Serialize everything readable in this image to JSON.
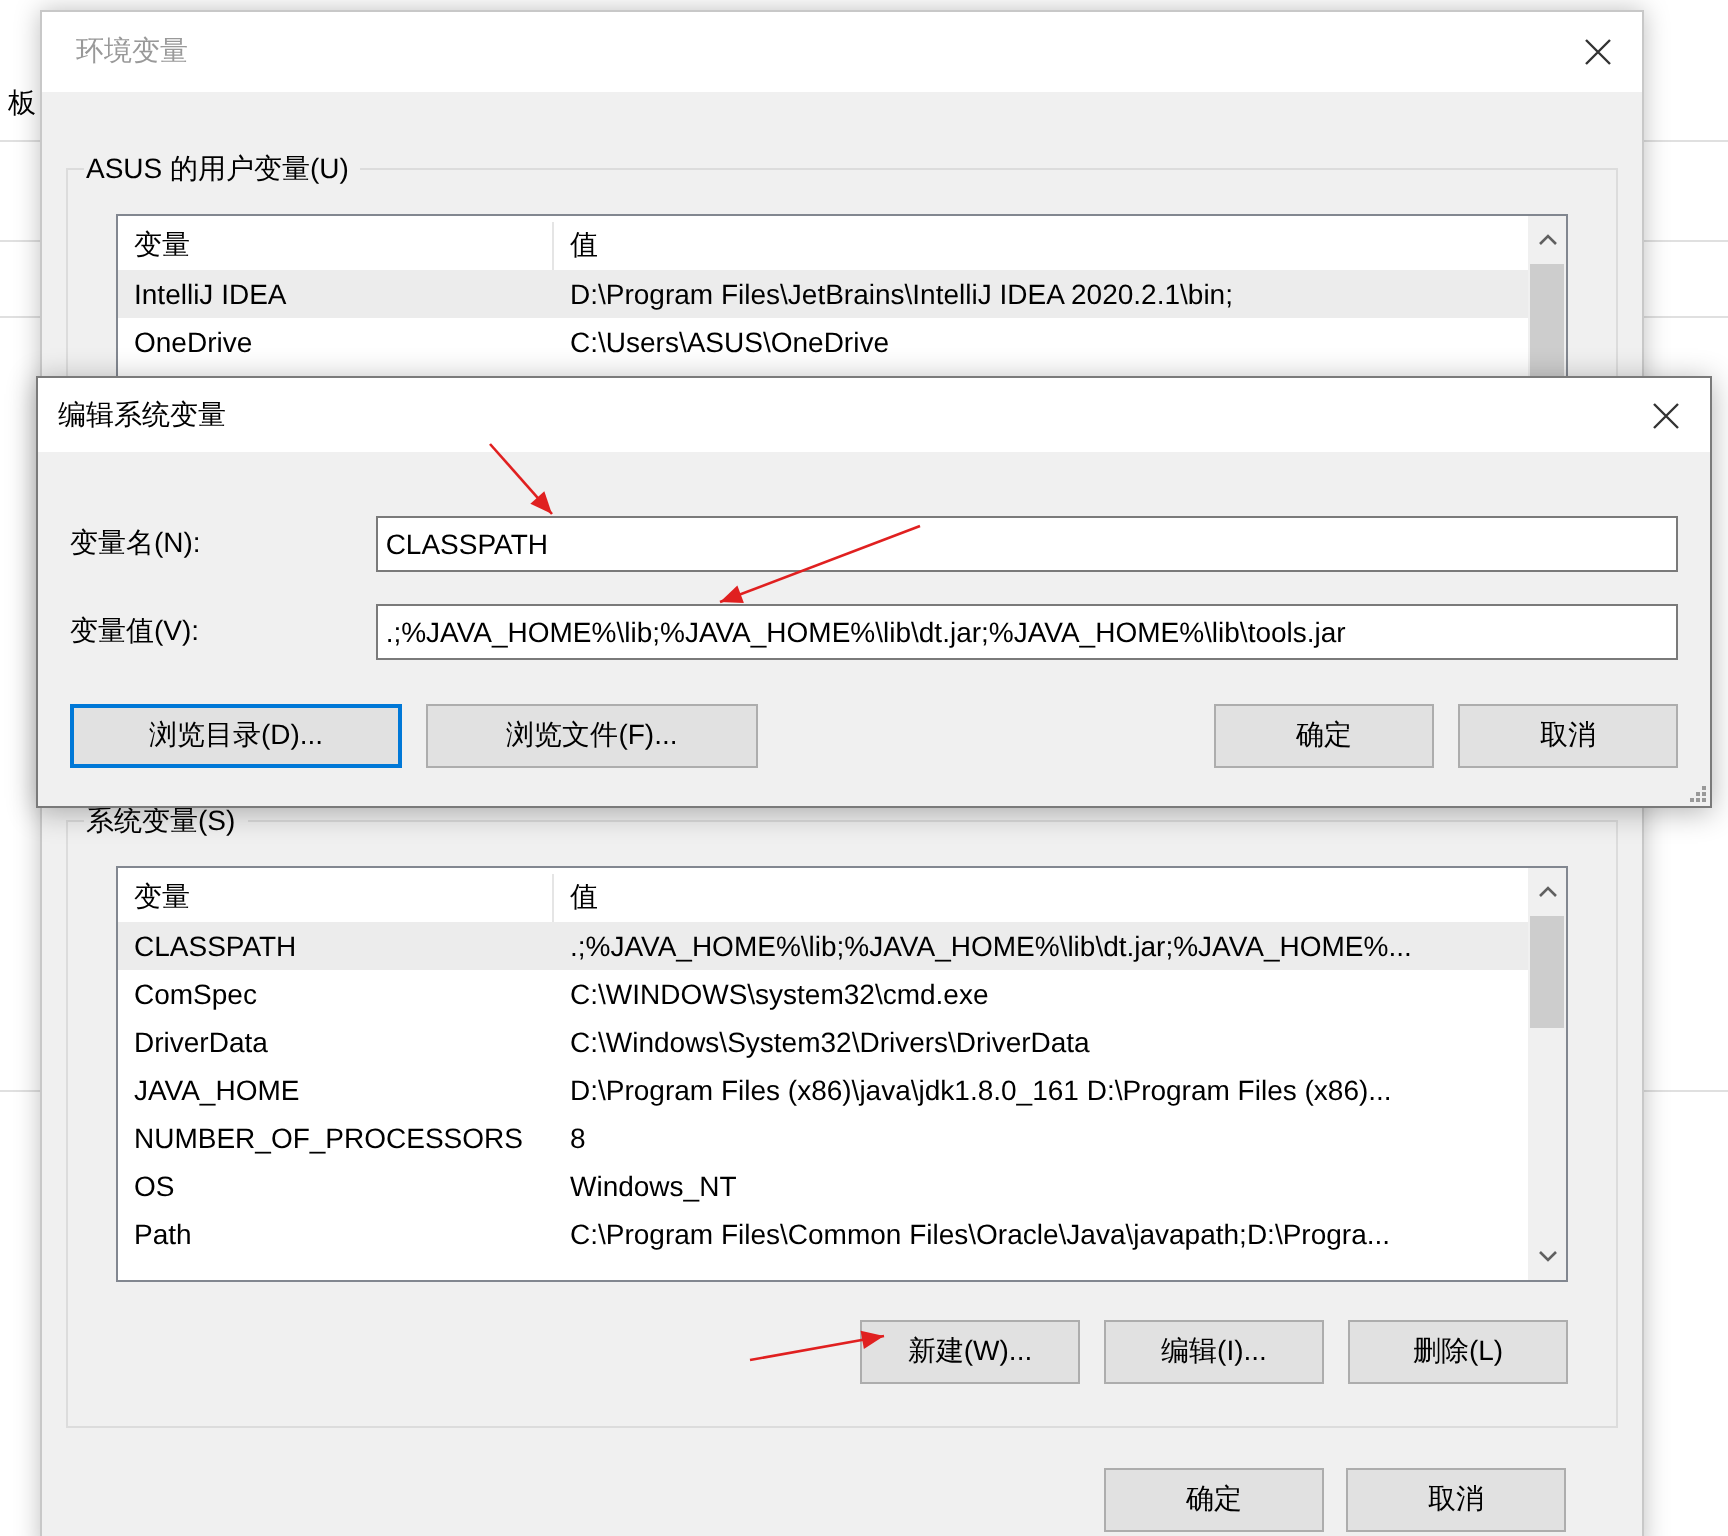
{
  "background": {
    "label": "板"
  },
  "env_dialog": {
    "title": "环境变量",
    "user_vars": {
      "title": "ASUS 的用户变量(U)",
      "columns": [
        "变量",
        "值"
      ],
      "rows": [
        {
          "name": "IntelliJ IDEA",
          "value": "D:\\Program Files\\JetBrains\\IntelliJ IDEA 2020.2.1\\bin;",
          "selected": true
        },
        {
          "name": "OneDrive",
          "value": "C:\\Users\\ASUS\\OneDrive",
          "selected": false
        }
      ]
    },
    "system_vars": {
      "title": "系统变量(S)",
      "columns": [
        "变量",
        "值"
      ],
      "rows": [
        {
          "name": "CLASSPATH",
          "value": ".;%JAVA_HOME%\\lib;%JAVA_HOME%\\lib\\dt.jar;%JAVA_HOME%...",
          "selected": true
        },
        {
          "name": "ComSpec",
          "value": "C:\\WINDOWS\\system32\\cmd.exe",
          "selected": false
        },
        {
          "name": "DriverData",
          "value": "C:\\Windows\\System32\\Drivers\\DriverData",
          "selected": false
        },
        {
          "name": "JAVA_HOME",
          "value": "D:\\Program Files (x86)\\java\\jdk1.8.0_161  D:\\Program Files (x86)...",
          "selected": false
        },
        {
          "name": "NUMBER_OF_PROCESSORS",
          "value": "8",
          "selected": false
        },
        {
          "name": "OS",
          "value": "Windows_NT",
          "selected": false
        },
        {
          "name": "Path",
          "value": "C:\\Program Files\\Common Files\\Oracle\\Java\\javapath;D:\\Progra...",
          "selected": false
        }
      ],
      "buttons": [
        "新建(W)...",
        "编辑(I)...",
        "删除(L)"
      ]
    },
    "buttons": [
      "确定",
      "取消"
    ]
  },
  "edit_dialog": {
    "title": "编辑系统变量",
    "fields": [
      {
        "label": "变量名(N):",
        "value": "CLASSPATH"
      },
      {
        "label": "变量值(V):",
        "value": ".;%JAVA_HOME%\\lib;%JAVA_HOME%\\lib\\dt.jar;%JAVA_HOME%\\lib\\tools.jar"
      }
    ],
    "buttons": [
      {
        "label": "浏览目录(D)...",
        "focused": true
      },
      {
        "label": "浏览文件(F)...",
        "focused": false
      },
      {
        "label": "确定",
        "focused": false
      },
      {
        "label": "取消",
        "focused": false
      }
    ]
  }
}
